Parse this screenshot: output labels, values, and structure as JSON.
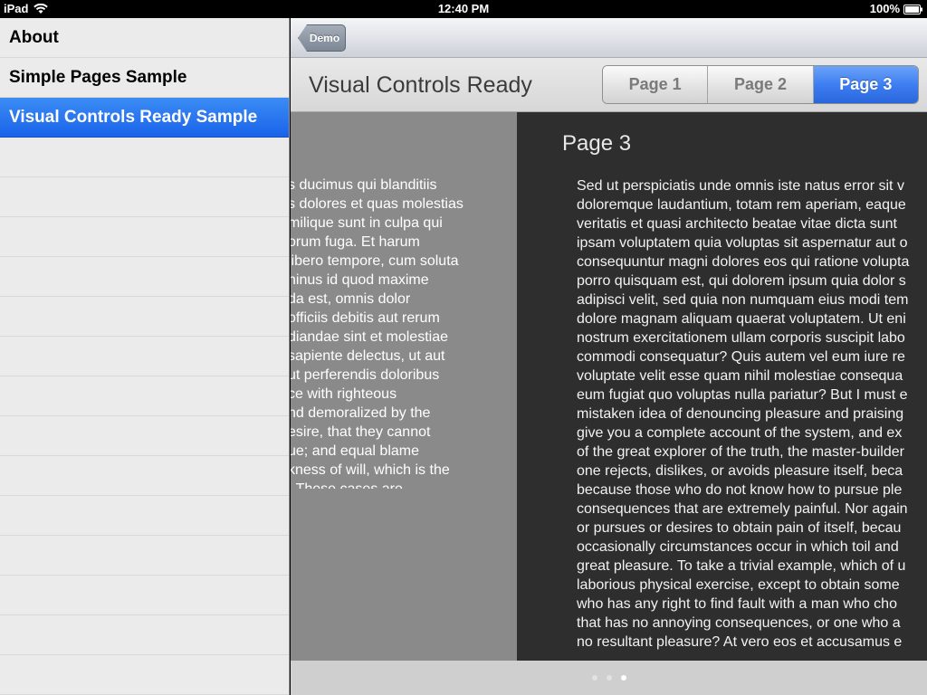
{
  "status_bar": {
    "device": "iPad",
    "time": "12:40 PM",
    "battery": "100%"
  },
  "sidebar": {
    "items": [
      {
        "label": "About",
        "selected": false
      },
      {
        "label": "Simple Pages Sample",
        "selected": false
      },
      {
        "label": "Visual Controls Ready Sample",
        "selected": true
      }
    ]
  },
  "nav": {
    "back_label": "Demo"
  },
  "toolbar": {
    "title": "Visual Controls Ready",
    "segments": [
      {
        "label": "Page 1",
        "active": false
      },
      {
        "label": "Page 2",
        "active": false
      },
      {
        "label": "Page 3",
        "active": true
      }
    ]
  },
  "previous_page": {
    "lines": [
      "s ducimus qui blanditiis",
      "s dolores et quas molestias",
      "milique sunt in culpa qui",
      "orum fuga. Et harum",
      "libero tempore, cum soluta",
      "ninus id quod maxime",
      "da est, omnis dolor",
      "officiis debitis aut rerum",
      "diandae sint et molestiae",
      "sapiente delectus, ut aut",
      "ut perferendis doloribus",
      "ce with righteous",
      "nd demoralized by the",
      "esire, that they cannot",
      "ue; and equal blame",
      "kness of will, which is the",
      ". These cases are"
    ]
  },
  "current_page": {
    "title": "Page 3",
    "lines": [
      "Sed ut perspiciatis unde omnis iste natus error sit v",
      "doloremque laudantium, totam rem aperiam, eaque",
      "veritatis et quasi architecto beatae vitae dicta sunt",
      "ipsam voluptatem quia voluptas sit aspernatur aut o",
      "consequuntur magni dolores eos qui ratione volupta",
      "porro quisquam est, qui dolorem ipsum quia dolor s",
      "adipisci velit, sed quia non numquam eius modi tem",
      "dolore magnam aliquam quaerat voluptatem. Ut eni",
      "nostrum exercitationem ullam corporis suscipit labo",
      "commodi consequatur? Quis autem vel eum iure re",
      "voluptate velit esse quam nihil molestiae consequa",
      "eum fugiat quo voluptas nulla pariatur? But I must e",
      "mistaken idea of denouncing pleasure and praising",
      "give you a complete account of the system, and ex",
      "of the great explorer of the truth, the master-builder",
      "one rejects, dislikes, or avoids pleasure itself, beca",
      "because those who do not know how to pursue ple",
      "consequences that are extremely painful. Nor again",
      "or pursues or desires to obtain pain of itself, becau",
      "occasionally circumstances occur in which toil and",
      "great pleasure. To take a trivial example, which of u",
      "laborious physical exercise, except to obtain some",
      "who has any right to find fault with a man who cho",
      "that has no annoying consequences, or one who a",
      "no resultant pleasure? At vero eos et accusamus e"
    ]
  },
  "page_indicator": {
    "total": 3,
    "current": 3
  },
  "colors": {
    "selection_blue": "#1a63ea",
    "segment_active": "#3d7ef1",
    "page_dark": "#2e2e2e",
    "page_prev": "#8a8a8a"
  }
}
